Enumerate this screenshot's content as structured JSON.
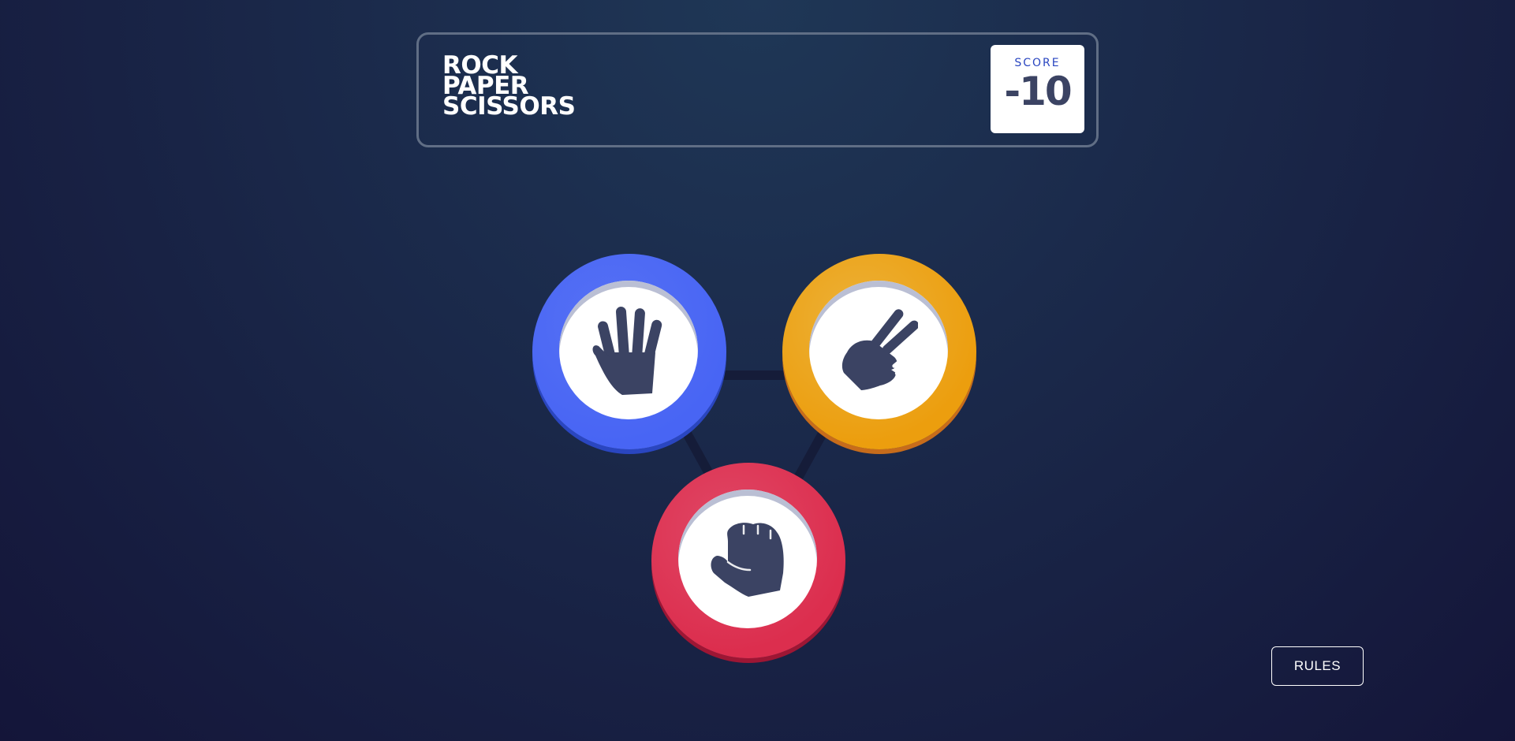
{
  "header": {
    "title_lines": [
      "ROCK",
      "PAPER",
      "SCISSORS"
    ],
    "score_label": "SCORE",
    "score_value": "-10"
  },
  "choices": [
    {
      "id": "paper",
      "icon": "paper-hand-icon",
      "color": "#4865f4"
    },
    {
      "id": "scissors",
      "icon": "scissors-hand-icon",
      "color": "#ec9e0e"
    },
    {
      "id": "rock",
      "icon": "rock-fist-icon",
      "color": "#dc2e4e"
    }
  ],
  "rules_button": {
    "label": "RULES"
  },
  "colors": {
    "background_top": "#1f3756",
    "background_bottom": "#141539",
    "header_border": "#606e85",
    "score_label": "#2a46c0",
    "score_value": "#3b4363"
  }
}
